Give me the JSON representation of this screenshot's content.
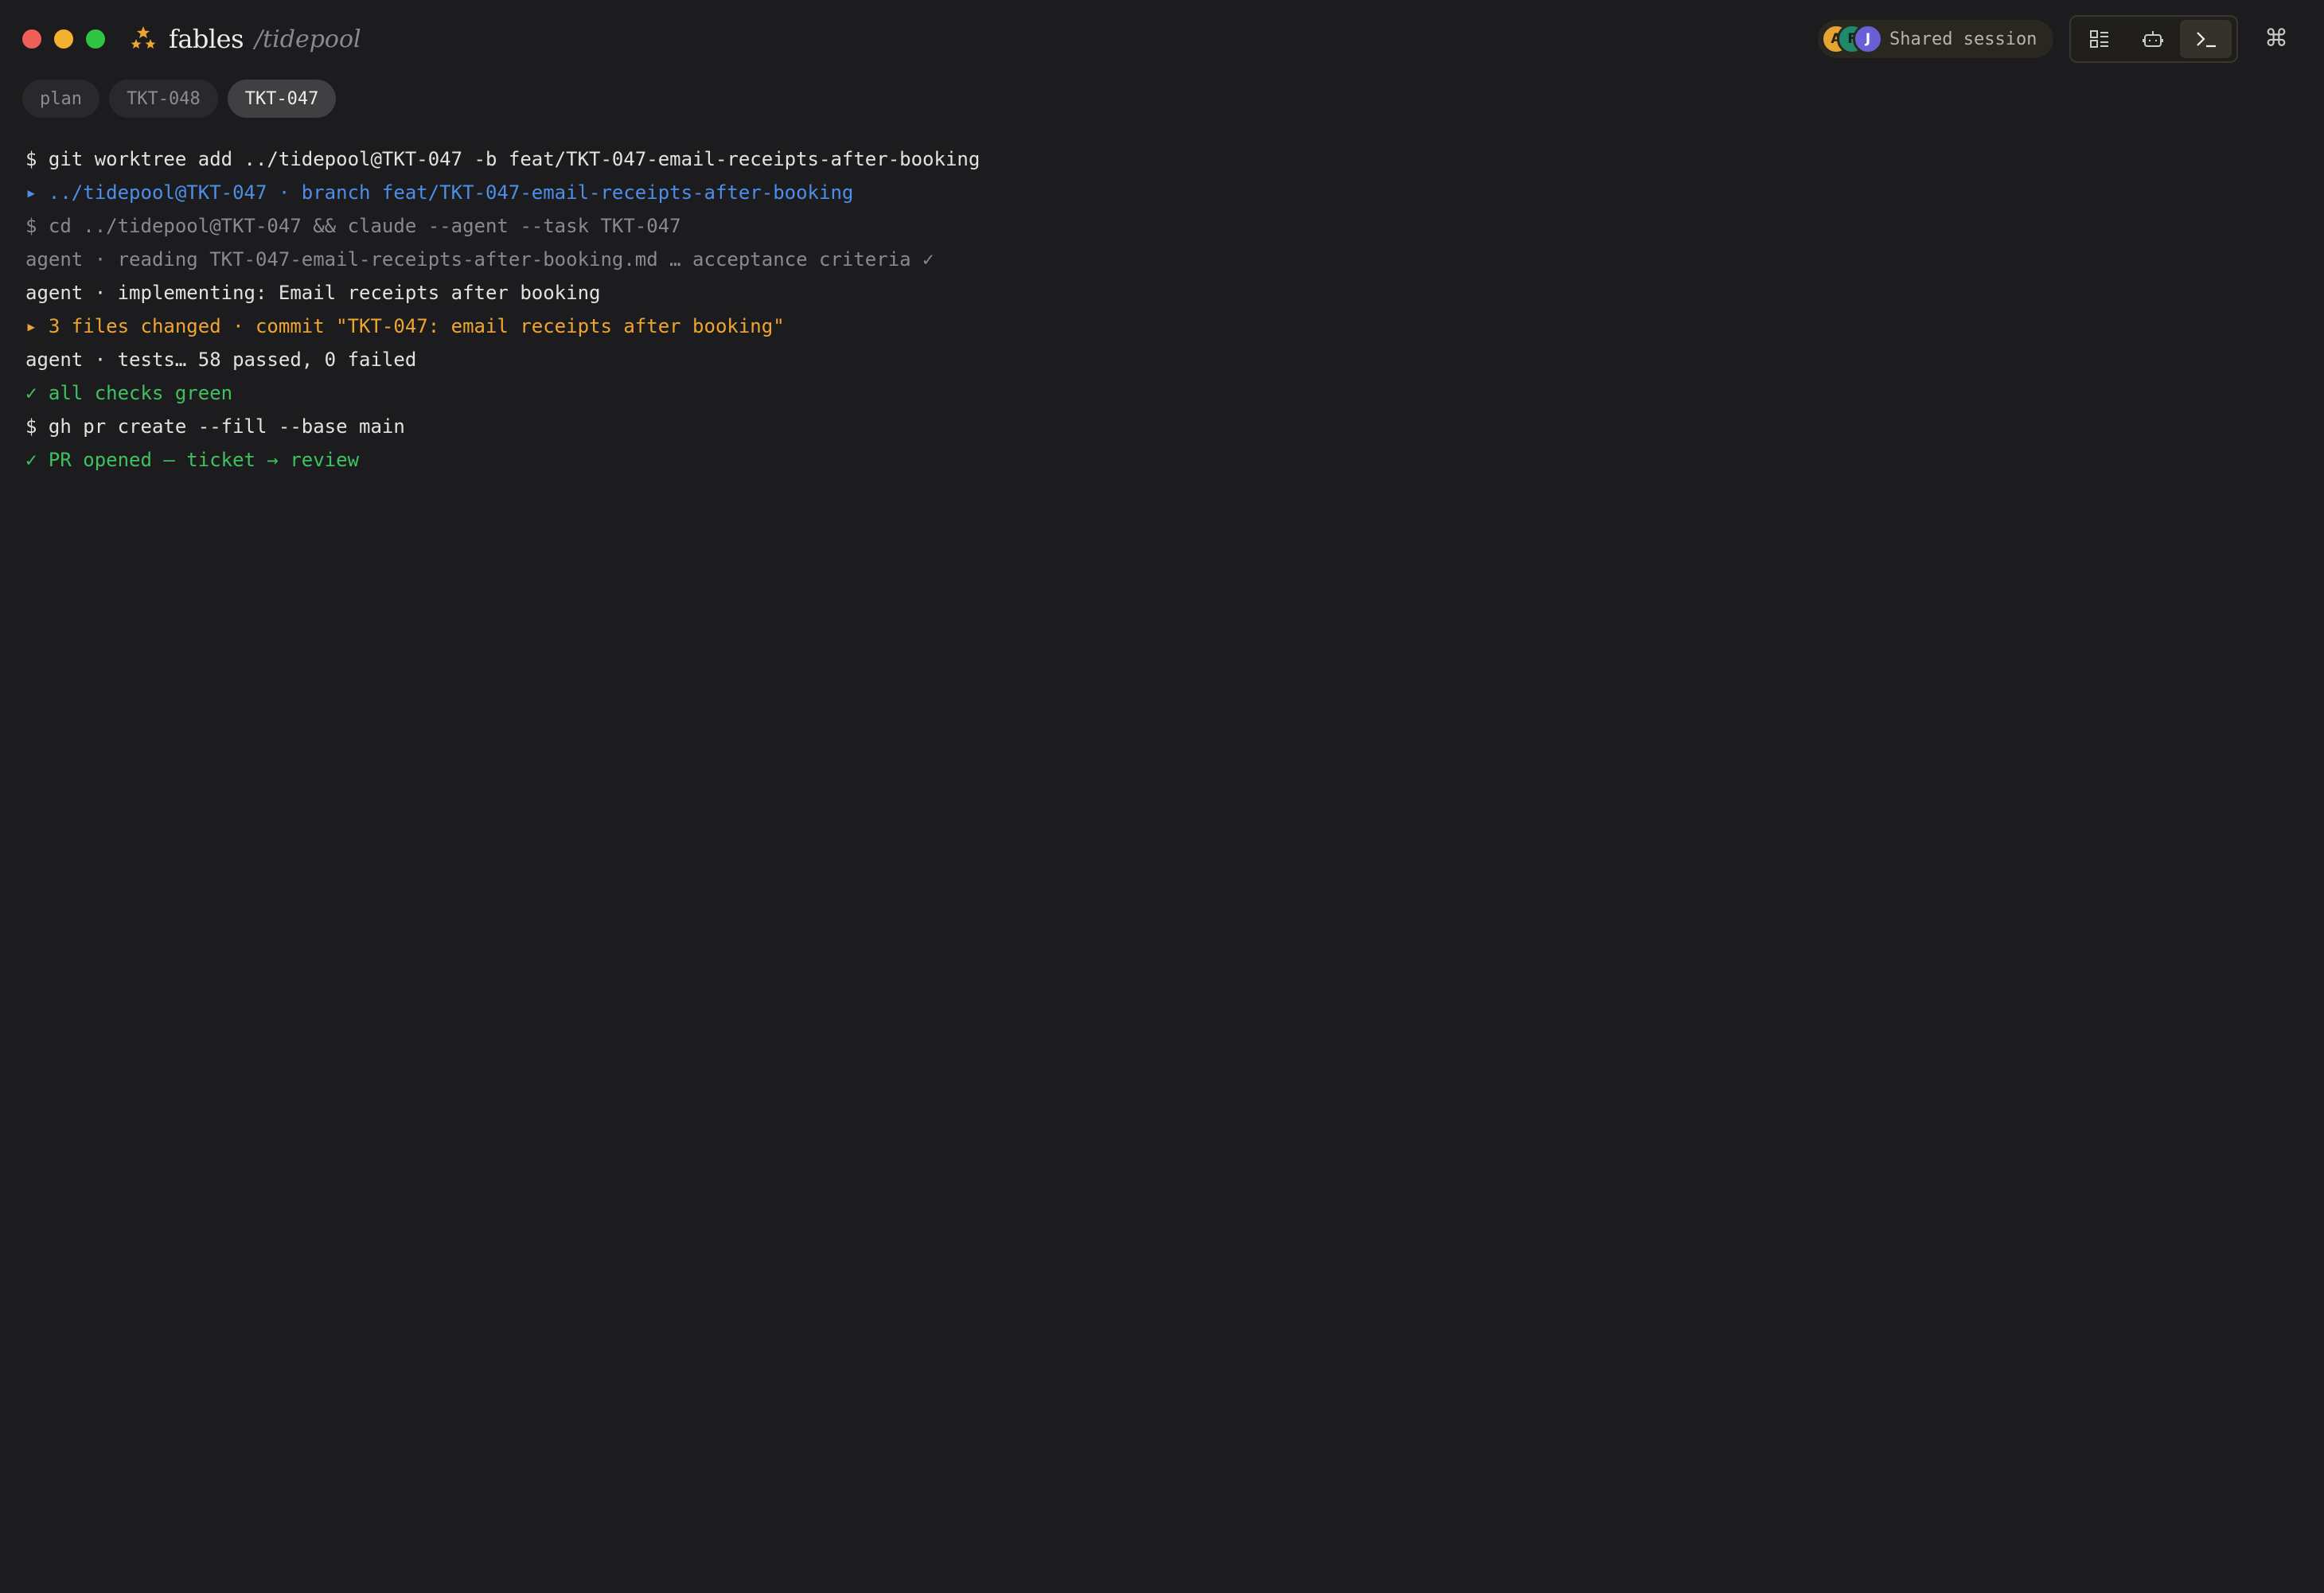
{
  "window": {
    "brand": "fables",
    "project_path": "/tidepool"
  },
  "session": {
    "label": "Shared session",
    "avatars": [
      "A",
      "F",
      "J"
    ]
  },
  "view_switcher": {
    "buttons": [
      "board-icon",
      "agent-icon",
      "terminal-icon"
    ],
    "active": "terminal-icon"
  },
  "command_key": "⌘",
  "tabs": [
    {
      "label": "plan",
      "active": false
    },
    {
      "label": "TKT-048",
      "active": false
    },
    {
      "label": "TKT-047",
      "active": true
    }
  ],
  "terminal": {
    "lines": [
      {
        "text": "$ git worktree add ../tidepool@TKT-047 -b feat/TKT-047-email-receipts-after-booking",
        "color": "#e2e2e2"
      },
      {
        "text": "▸ ../tidepool@TKT-047 · branch feat/TKT-047-email-receipts-after-booking",
        "color": "#4c8fe8"
      },
      {
        "text": "$ cd ../tidepool@TKT-047 && claude --agent --task TKT-047",
        "color": "#8a8a8e"
      },
      {
        "text": "agent · reading TKT-047-email-receipts-after-booking.md … acceptance criteria ✓",
        "color": "#8a8a8e"
      },
      {
        "text": "agent · implementing: Email receipts after booking",
        "color": "#e2e2e2"
      },
      {
        "text": "▸ 3 files changed · commit \"TKT-047: email receipts after booking\"",
        "color": "#efa531"
      },
      {
        "text": "agent · tests… 58 passed, 0 failed",
        "color": "#e2e2e2"
      },
      {
        "text": "✓ all checks green",
        "color": "#3fc160"
      },
      {
        "text": "$ gh pr create --fill --base main",
        "color": "#e2e2e2"
      },
      {
        "text": "✓ PR opened — ticket → review",
        "color": "#3fc160"
      }
    ]
  }
}
